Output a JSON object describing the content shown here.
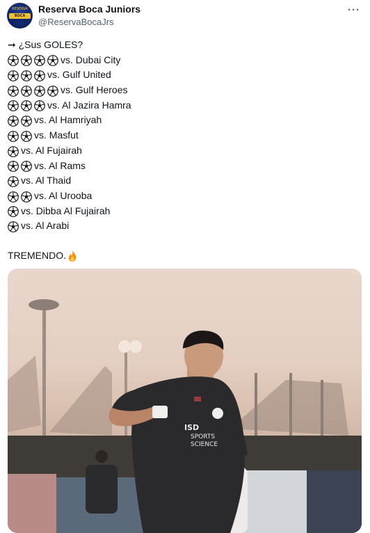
{
  "account": {
    "name": "Reserva Boca Juniors",
    "handle": "@ReservaBocaJrs",
    "more_label": "···",
    "avatar_icon": "club-crest-icon",
    "avatar_top_text": "RESERVA",
    "avatar_band_text": "BOCA JUNIORS"
  },
  "tweet": {
    "intro": "➞ ¿Sus GOLES?",
    "goals": [
      {
        "balls": 4,
        "rival": "vs. Dubai City"
      },
      {
        "balls": 3,
        "rival": "vs. Gulf United"
      },
      {
        "balls": 4,
        "rival": "vs. Gulf Heroes"
      },
      {
        "balls": 3,
        "rival": "vs. Al Jazira Hamra"
      },
      {
        "balls": 2,
        "rival": "vs. Al Hamriyah"
      },
      {
        "balls": 2,
        "rival": "vs. Masfut"
      },
      {
        "balls": 1,
        "rival": "vs. Al Fujairah"
      },
      {
        "balls": 2,
        "rival": "vs. Al Rams"
      },
      {
        "balls": 1,
        "rival": "vs. Al Thaid"
      },
      {
        "balls": 2,
        "rival": "vs. Al Urooba"
      },
      {
        "balls": 1,
        "rival": "vs. Dibba Al Fujairah"
      },
      {
        "balls": 1,
        "rival": "vs. Al Arabi"
      }
    ],
    "closing": "TREMENDO.",
    "closing_icon": "fire-icon",
    "ball_icon": "soccer-ball-icon"
  },
  "media": {
    "description_icon": "photo-player-celebrating",
    "shirt_sponsor_line1": "ISD",
    "shirt_sponsor_line2": "SPORTS",
    "shirt_sponsor_line3": "SCIENCE"
  }
}
